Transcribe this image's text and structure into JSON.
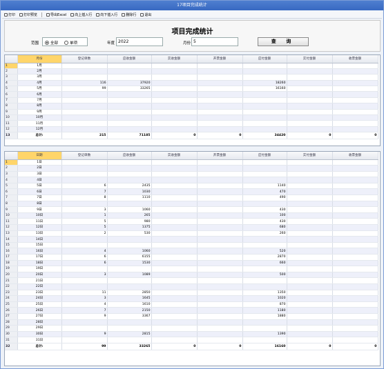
{
  "window": {
    "title": "17项目完成统计"
  },
  "toolbar": {
    "items": [
      "打印",
      "打印预览",
      "导出Excel",
      "向上插入行",
      "向下插入行",
      "删除行",
      "退出"
    ]
  },
  "form": {
    "title": "项目完成统计",
    "scope_label": "范围",
    "opt_all": "全部",
    "opt_single": "单项",
    "year_label": "年度",
    "year_value": "2022",
    "month_label": "月份",
    "month_value": "5",
    "query_button": "查  询"
  },
  "columns": [
    "登记单数",
    "应收金额",
    "实收金额",
    "开票金额",
    "应付金额",
    "实付金额",
    "收票金额"
  ],
  "monthly": {
    "first_header": "月份",
    "rows": [
      {
        "n": "1",
        "label": "1月",
        "v": [
          "",
          "",
          "",
          "",
          "",
          "",
          ""
        ]
      },
      {
        "n": "2",
        "label": "2月",
        "v": [
          "",
          "",
          "",
          "",
          "",
          "",
          ""
        ]
      },
      {
        "n": "3",
        "label": "3月",
        "v": [
          "",
          "",
          "",
          "",
          "",
          "",
          ""
        ]
      },
      {
        "n": "4",
        "label": "4月",
        "v": [
          "116",
          "37920",
          "",
          "",
          "18260",
          "",
          ""
        ]
      },
      {
        "n": "5",
        "label": "5月",
        "v": [
          "99",
          "33265",
          "",
          "",
          "16160",
          "",
          ""
        ]
      },
      {
        "n": "6",
        "label": "6月",
        "v": [
          "",
          "",
          "",
          "",
          "",
          "",
          ""
        ]
      },
      {
        "n": "7",
        "label": "7月",
        "v": [
          "",
          "",
          "",
          "",
          "",
          "",
          ""
        ]
      },
      {
        "n": "8",
        "label": "8月",
        "v": [
          "",
          "",
          "",
          "",
          "",
          "",
          ""
        ]
      },
      {
        "n": "9",
        "label": "9月",
        "v": [
          "",
          "",
          "",
          "",
          "",
          "",
          ""
        ]
      },
      {
        "n": "10",
        "label": "10月",
        "v": [
          "",
          "",
          "",
          "",
          "",
          "",
          ""
        ]
      },
      {
        "n": "11",
        "label": "11月",
        "v": [
          "",
          "",
          "",
          "",
          "",
          "",
          ""
        ]
      },
      {
        "n": "12",
        "label": "12月",
        "v": [
          "",
          "",
          "",
          "",
          "",
          "",
          ""
        ]
      }
    ],
    "total": {
      "n": "13",
      "label": "总计:",
      "v": [
        "215",
        "71185",
        "0",
        "0",
        "34420",
        "0",
        "0"
      ]
    }
  },
  "daily": {
    "first_header": "日期",
    "rows": [
      {
        "n": "1",
        "label": "1日",
        "v": [
          "",
          "",
          "",
          "",
          "",
          "",
          ""
        ]
      },
      {
        "n": "2",
        "label": "2日",
        "v": [
          "",
          "",
          "",
          "",
          "",
          "",
          ""
        ]
      },
      {
        "n": "3",
        "label": "3日",
        "v": [
          "",
          "",
          "",
          "",
          "",
          "",
          ""
        ]
      },
      {
        "n": "4",
        "label": "4日",
        "v": [
          "",
          "",
          "",
          "",
          "",
          "",
          ""
        ]
      },
      {
        "n": "5",
        "label": "5日",
        "v": [
          "6",
          "2435",
          "",
          "",
          "1140",
          "",
          ""
        ]
      },
      {
        "n": "6",
        "label": "6日",
        "v": [
          "7",
          "1030",
          "",
          "",
          "470",
          "",
          ""
        ]
      },
      {
        "n": "7",
        "label": "7日",
        "v": [
          "8",
          "1110",
          "",
          "",
          "490",
          "",
          ""
        ]
      },
      {
        "n": "8",
        "label": "8日",
        "v": [
          "",
          "",
          "",
          "",
          "",
          "",
          ""
        ]
      },
      {
        "n": "9",
        "label": "9日",
        "v": [
          "3",
          "1060",
          "",
          "",
          "430",
          "",
          ""
        ]
      },
      {
        "n": "10",
        "label": "10日",
        "v": [
          "1",
          "265",
          "",
          "",
          "100",
          "",
          ""
        ]
      },
      {
        "n": "11",
        "label": "11日",
        "v": [
          "5",
          "980",
          "",
          "",
          "430",
          "",
          ""
        ]
      },
      {
        "n": "12",
        "label": "12日",
        "v": [
          "5",
          "1375",
          "",
          "",
          "680",
          "",
          ""
        ]
      },
      {
        "n": "13",
        "label": "13日",
        "v": [
          "2",
          "530",
          "",
          "",
          "260",
          "",
          ""
        ]
      },
      {
        "n": "14",
        "label": "14日",
        "v": [
          "",
          "",
          "",
          "",
          "",
          "",
          ""
        ]
      },
      {
        "n": "15",
        "label": "15日",
        "v": [
          "",
          "",
          "",
          "",
          "",
          "",
          ""
        ]
      },
      {
        "n": "16",
        "label": "16日",
        "v": [
          "4",
          "1060",
          "",
          "",
          "520",
          "",
          ""
        ]
      },
      {
        "n": "17",
        "label": "17日",
        "v": [
          "6",
          "6155",
          "",
          "",
          "2870",
          "",
          ""
        ]
      },
      {
        "n": "18",
        "label": "18日",
        "v": [
          "6",
          "1530",
          "",
          "",
          "660",
          "",
          ""
        ]
      },
      {
        "n": "19",
        "label": "19日",
        "v": [
          "",
          "",
          "",
          "",
          "",
          "",
          ""
        ]
      },
      {
        "n": "20",
        "label": "20日",
        "v": [
          "3",
          "1089",
          "",
          "",
          "500",
          "",
          ""
        ]
      },
      {
        "n": "21",
        "label": "21日",
        "v": [
          "",
          "",
          "",
          "",
          "",
          "",
          ""
        ]
      },
      {
        "n": "22",
        "label": "22日",
        "v": [
          "",
          "",
          "",
          "",
          "",
          "",
          ""
        ]
      },
      {
        "n": "23",
        "label": "23日",
        "v": [
          "11",
          "2850",
          "",
          "",
          "1350",
          "",
          ""
        ]
      },
      {
        "n": "24",
        "label": "24日",
        "v": [
          "3",
          "1645",
          "",
          "",
          "1020",
          "",
          ""
        ]
      },
      {
        "n": "25",
        "label": "25日",
        "v": [
          "4",
          "1610",
          "",
          "",
          "870",
          "",
          ""
        ]
      },
      {
        "n": "26",
        "label": "26日",
        "v": [
          "7",
          "2150",
          "",
          "",
          "1180",
          "",
          ""
        ]
      },
      {
        "n": "27",
        "label": "27日",
        "v": [
          "9",
          "3367",
          "",
          "",
          "1880",
          "",
          ""
        ]
      },
      {
        "n": "28",
        "label": "28日",
        "v": [
          "",
          "",
          "",
          "",
          "",
          "",
          ""
        ]
      },
      {
        "n": "29",
        "label": "29日",
        "v": [
          "",
          "",
          "",
          "",
          "",
          "",
          ""
        ]
      },
      {
        "n": "30",
        "label": "30日",
        "v": [
          "9",
          "2815",
          "",
          "",
          "1390",
          "",
          ""
        ]
      },
      {
        "n": "31",
        "label": "31日",
        "v": [
          "",
          "",
          "",
          "",
          "",
          "",
          ""
        ]
      }
    ],
    "total": {
      "n": "32",
      "label": "总计:",
      "v": [
        "99",
        "33265",
        "0",
        "0",
        "16160",
        "0",
        "0"
      ]
    }
  }
}
